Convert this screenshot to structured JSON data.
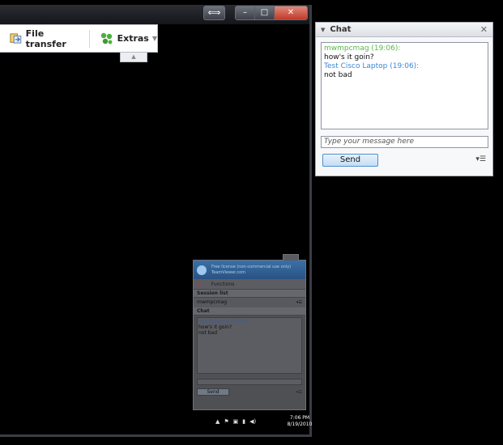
{
  "window": {
    "swap_label": "⟺",
    "min_label": "–",
    "max_label": "□",
    "close_label": "✕"
  },
  "toolbar": {
    "file_transfer": "File transfer",
    "extras": "Extras",
    "collapse_arrow": "▲"
  },
  "chat": {
    "title": "Chat",
    "close_label": "✕",
    "messages": [
      {
        "sender": "mwmpcmag (19:06):",
        "text": "how's it goin?"
      },
      {
        "sender": "Test Cisco Laptop (19:06):",
        "text": "not bad"
      }
    ],
    "input_placeholder": "Type your message here",
    "send_label": "Send",
    "options_label": "▾☰"
  },
  "mini_panel": {
    "header_line1": "Free license (non-commercial use only)",
    "header_line2": "TeamViewer.com",
    "functions_label": "Functions",
    "session_list_title": "Session list",
    "session_user": "mwmpcmag",
    "chat_title": "Chat",
    "log_sender": "mwmpcmag (19:06):",
    "log_line1": "how's it goin?",
    "log_line2": "not bad",
    "send_label": "Send"
  },
  "tray": {
    "time": "7:06 PM",
    "date": "8/19/2010"
  },
  "colors": {
    "sender_local": "#58b84a",
    "sender_remote": "#3b87d4",
    "send_button_border": "#4d8fd0",
    "close_red": "#c0392b"
  }
}
